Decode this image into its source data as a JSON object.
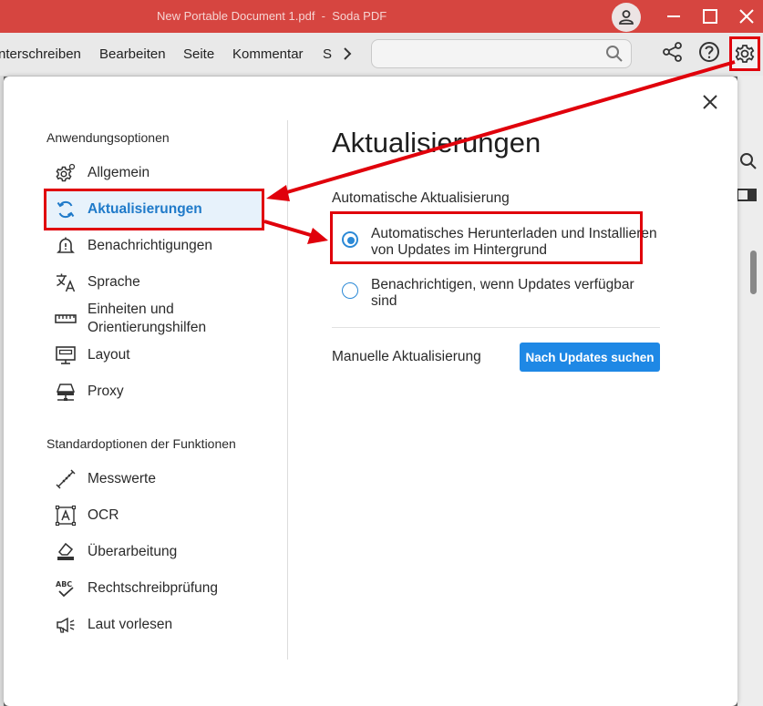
{
  "window": {
    "title": "New Portable Document 1.pdf  -  Soda PDF"
  },
  "menubar": {
    "items": [
      "nterschreiben",
      "Bearbeiten",
      "Seite",
      "Kommentar",
      "S"
    ]
  },
  "dialog": {
    "left_section_title": "Anwendungsoptionen",
    "app_options": [
      {
        "label": "Allgemein",
        "icon": "gear-icon"
      },
      {
        "label": "Aktualisierungen",
        "icon": "refresh-icon",
        "active": true
      },
      {
        "label": "Benachrichtigungen",
        "icon": "bell-icon"
      },
      {
        "label": "Sprache",
        "icon": "translate-icon"
      },
      {
        "label": "Einheiten und Orientierungshilfen",
        "icon": "ruler-icon"
      },
      {
        "label": "Layout",
        "icon": "layout-icon"
      },
      {
        "label": "Proxy",
        "icon": "proxy-icon"
      }
    ],
    "feature_section_title": "Standardoptionen der Funktionen",
    "feature_options": [
      {
        "label": "Messwerte",
        "icon": "measure-icon"
      },
      {
        "label": "OCR",
        "icon": "ocr-icon"
      },
      {
        "label": "Überarbeitung",
        "icon": "eraser-icon"
      },
      {
        "label": "Rechtschreibprüfung",
        "icon": "spellcheck-icon"
      },
      {
        "label": "Laut vorlesen",
        "icon": "megaphone-icon"
      }
    ],
    "heading": "Aktualisierungen",
    "auto_update_title": "Automatische Aktualisierung",
    "radio_options": [
      {
        "label": "Automatisches Herunterladen und Installieren von Updates im Hintergrund",
        "checked": true
      },
      {
        "label": "Benachrichtigen, wenn Updates verfügbar sind",
        "checked": false
      }
    ],
    "manual_update_label": "Manuelle Aktualisierung",
    "check_button_label": "Nach Updates suchen"
  },
  "colors": {
    "titlebar": "#d64540",
    "accent": "#1e88e5",
    "annotation_red": "#e0000b",
    "active_nav_bg": "#e7f2fb"
  }
}
